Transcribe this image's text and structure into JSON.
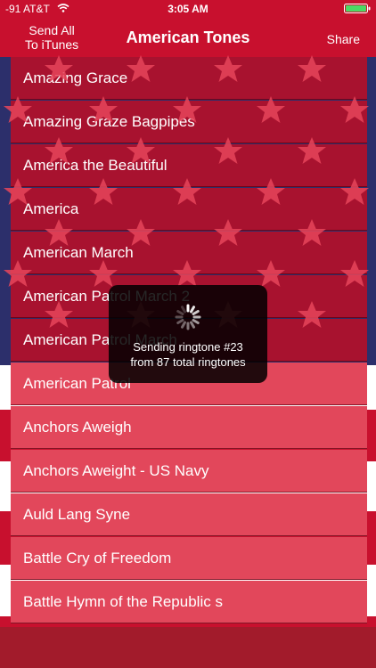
{
  "status_bar": {
    "carrier": "-91 AT&T",
    "time": "3:05 AM"
  },
  "nav": {
    "left_label_line1": "Send All",
    "left_label_line2": "To iTunes",
    "title": "American Tones",
    "right_label": "Share"
  },
  "ringtones": [
    "Amazing Grace",
    "Amazing Graze Bagpipes",
    "America the Beautiful",
    "America",
    "American March",
    "American Patrol March 2",
    "American Patrol March",
    "American Patrol",
    "Anchors Aweigh",
    "Anchors Aweight - US Navy",
    "Auld Lang Syne",
    "Battle Cry of Freedom",
    "Battle Hymn of the Republic s"
  ],
  "progress_hud": {
    "line1": "Sending ringtone #23",
    "line2": "from 87 total ringtones"
  },
  "colors": {
    "bar_red": "#c8102e",
    "row_dark": "#a8122f",
    "row_light": "#e2475b",
    "canton_blue": "#2c2f6b"
  },
  "icons": [
    "wifi-icon",
    "battery-icon",
    "spinner-icon",
    "star-icon"
  ]
}
